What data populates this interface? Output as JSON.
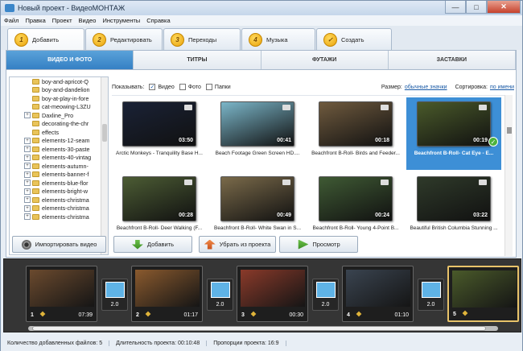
{
  "window": {
    "title": "Новый проект - ВидеоМОНТАЖ"
  },
  "menu": [
    "Файл",
    "Правка",
    "Проект",
    "Видео",
    "Инструменты",
    "Справка"
  ],
  "steps": [
    {
      "num": "1",
      "label": "Добавить",
      "active": true
    },
    {
      "num": "2",
      "label": "Редактировать"
    },
    {
      "num": "3",
      "label": "Переходы"
    },
    {
      "num": "4",
      "label": "Музыка"
    },
    {
      "num": "✓",
      "label": "Создать"
    }
  ],
  "subtabs": [
    "ВИДЕО И ФОТО",
    "ТИТРЫ",
    "ФУТАЖИ",
    "ЗАСТАВКИ"
  ],
  "tree": [
    {
      "label": "boy-and-apricot-Q",
      "exp": false
    },
    {
      "label": "boy-and-dandelion",
      "exp": false
    },
    {
      "label": "boy-at-play-in-fore",
      "exp": false
    },
    {
      "label": "cat-meowing-L3ZU",
      "exp": false
    },
    {
      "label": "Daxline_Pro",
      "exp": true
    },
    {
      "label": "decorating-the-chr",
      "exp": false
    },
    {
      "label": "effects",
      "exp": false
    },
    {
      "label": "elements-12-seam",
      "exp": true
    },
    {
      "label": "elements-30-paste",
      "exp": true
    },
    {
      "label": "elements-40-vintag",
      "exp": true
    },
    {
      "label": "elements-autumn-",
      "exp": true
    },
    {
      "label": "elements-banner-f",
      "exp": true
    },
    {
      "label": "elements-blue-flor",
      "exp": true
    },
    {
      "label": "elements-bright-w",
      "exp": true
    },
    {
      "label": "elements-christma",
      "exp": true
    },
    {
      "label": "elements-christma",
      "exp": true
    },
    {
      "label": "elements-christma",
      "exp": true
    }
  ],
  "filter": {
    "show_label": "Показывать:",
    "video": "Видео",
    "photo": "Фото",
    "folders": "Папки",
    "size_label": "Размер:",
    "size_value": "обычные значки",
    "sort_label": "Сортировка:",
    "sort_value": "по имени"
  },
  "media": [
    {
      "name": "Arctic Monkeys - Tranquility Base H...",
      "dur": "03:50",
      "bg": "#1a2236"
    },
    {
      "name": "Beach Footage Green Screen HD....",
      "dur": "00:41",
      "bg": "#7bb6c9"
    },
    {
      "name": "Beachfront B-Roll- Birds and Feeder...",
      "dur": "00:18",
      "bg": "#6f5a3e"
    },
    {
      "name": "Beachfront B-Roll- Cat Eye - E...",
      "dur": "00:19",
      "bg": "#4a5a2a",
      "selected": true
    },
    {
      "name": "Beachfront B-Roll- Deer Walking (F...",
      "dur": "00:28",
      "bg": "#4c5c34"
    },
    {
      "name": "Beachfront B-Roll- White Swan in S...",
      "dur": "00:49",
      "bg": "#7a6a4a"
    },
    {
      "name": "Beachfront B-Roll- Young 4-Point B...",
      "dur": "00:24",
      "bg": "#3f5a34"
    },
    {
      "name": "Beautiful British Columbia Stunning ...",
      "dur": "03:22",
      "bg": "#2f3a2a"
    }
  ],
  "buttons": {
    "import": "Импортировать видео",
    "add": "Добавить",
    "remove": "Убрать из проекта",
    "preview": "Просмотр"
  },
  "timeline": {
    "clips": [
      {
        "num": "1",
        "dur": "07:39",
        "bg": "#6b4a2e"
      },
      {
        "num": "2",
        "dur": "01:17",
        "bg": "#8a5a2e"
      },
      {
        "num": "3",
        "dur": "00:30",
        "bg": "#8a3a2a"
      },
      {
        "num": "4",
        "dur": "01:10",
        "bg": "#3a4450"
      },
      {
        "num": "5",
        "dur": "",
        "bg": "#4a5a2a"
      }
    ],
    "transition_dur": "2.0"
  },
  "status": {
    "files": "Количество добавленных файлов: 5",
    "duration": "Длительность проекта:   00:10:48",
    "ratio": "Пропорции проекта:   16:9"
  }
}
